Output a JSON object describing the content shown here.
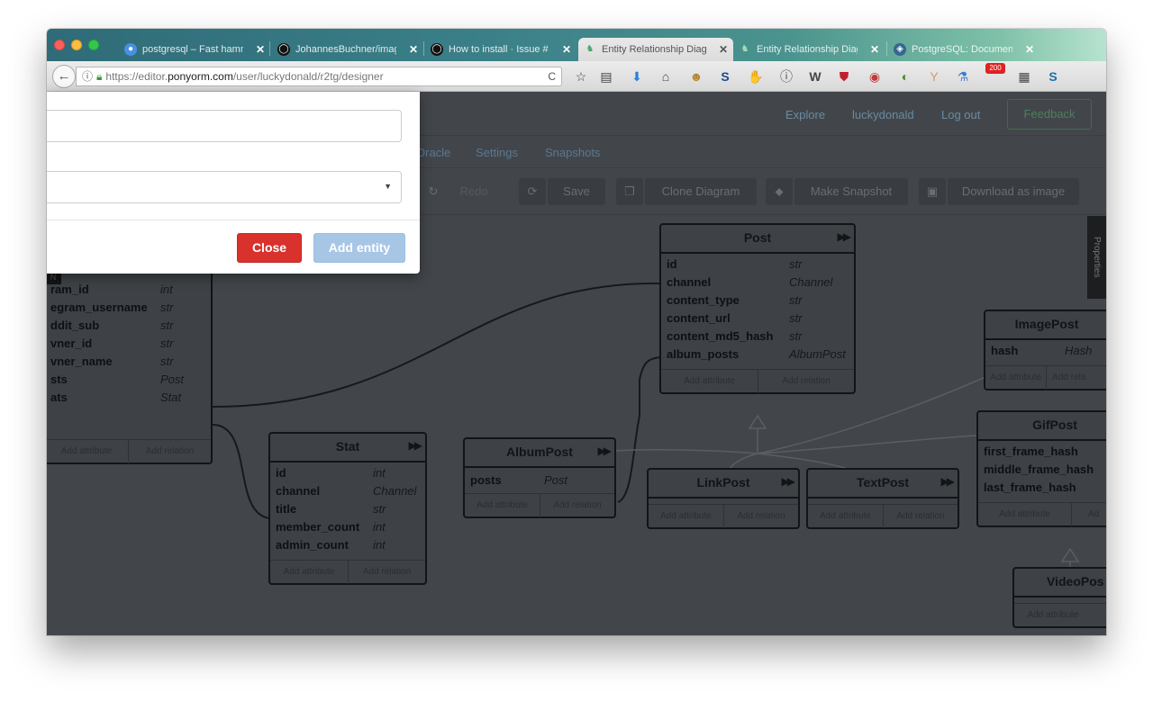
{
  "browser": {
    "tabs": [
      {
        "title": "postgresql – Fast hamm",
        "icon": "globe-icon",
        "icon_color": "#4a90e2"
      },
      {
        "title": "JohannesBuchner/imag",
        "icon": "github-icon",
        "icon_color": "#222222"
      },
      {
        "title": "How to install · Issue #",
        "icon": "github-icon",
        "icon_color": "#222222"
      },
      {
        "title": "Entity Relationship Diag",
        "icon": "ponyorm-icon",
        "icon_color": "#4ca36b"
      },
      {
        "title": "Entity Relationship Diag",
        "icon": "ponyorm-icon",
        "icon_color": "#4ca36b"
      },
      {
        "title": "PostgreSQL: Documen",
        "icon": "postgresql-icon",
        "icon_color": "#336791"
      }
    ],
    "url": {
      "prefix": "https://editor.",
      "domain": "ponyorm.com",
      "path": "/user/luckydonald/r2tg/designer"
    },
    "reload_glyph": "C",
    "toolbar_icons": [
      "☆",
      "▤",
      "⬇",
      "⌂",
      "☻",
      "S",
      "✋",
      "ⓘ",
      "W",
      "⛊",
      "◉",
      "◐",
      "Y",
      "⚗",
      "200",
      "▦",
      "S"
    ],
    "badge_200": "200"
  },
  "site_nav": {
    "explore": "Explore",
    "user": "luckydonald",
    "logout": "Log out",
    "feedback": "Feedback"
  },
  "sub_nav": {
    "oracle": "Oracle",
    "settings": "Settings",
    "snapshots": "Snapshots"
  },
  "toolbar": {
    "redo": "Redo",
    "save": "Save",
    "clone": "Clone Diagram",
    "snapshot": "Make Snapshot",
    "download": "Download as image"
  },
  "properties_tab": "Properties",
  "entities": {
    "left": {
      "attrs": [
        {
          "name": "ram_id",
          "type": "int"
        },
        {
          "name": "egram_username",
          "type": "str"
        },
        {
          "name": "ddit_sub",
          "type": "str"
        },
        {
          "name": "vner_id",
          "type": "str"
        },
        {
          "name": "vner_name",
          "type": "str"
        },
        {
          "name": "sts",
          "type": "Post"
        },
        {
          "name": "ats",
          "type": "Stat"
        }
      ],
      "marker": "N"
    },
    "post": {
      "title": "Post",
      "attrs": [
        {
          "name": "id",
          "type": "str"
        },
        {
          "name": "channel",
          "type": "Channel"
        },
        {
          "name": "content_type",
          "type": "str"
        },
        {
          "name": "content_url",
          "type": "str"
        },
        {
          "name": "content_md5_hash",
          "type": "str"
        },
        {
          "name": "album_posts",
          "type": "AlbumPost"
        }
      ]
    },
    "stat": {
      "title": "Stat",
      "attrs": [
        {
          "name": "id",
          "type": "int"
        },
        {
          "name": "channel",
          "type": "Channel"
        },
        {
          "name": "title",
          "type": "str"
        },
        {
          "name": "member_count",
          "type": "int"
        },
        {
          "name": "admin_count",
          "type": "int"
        }
      ]
    },
    "albumpost": {
      "title": "AlbumPost",
      "attrs": [
        {
          "name": "posts",
          "type": "Post"
        }
      ]
    },
    "linkpost": {
      "title": "LinkPost"
    },
    "textpost": {
      "title": "TextPost"
    },
    "imagepost": {
      "title": "ImagePost",
      "attrs": [
        {
          "name": "hash",
          "type": "Hash"
        }
      ]
    },
    "gifpost": {
      "title": "GifPost",
      "attrs": [
        {
          "name": "first_frame_hash",
          "type": ""
        },
        {
          "name": "middle_frame_hash",
          "type": ""
        },
        {
          "name": "last_frame_hash",
          "type": ""
        }
      ]
    },
    "videopost": {
      "title": "VideoPos"
    }
  },
  "entity_footer": {
    "add_attribute": "Add attribute",
    "add_relation": "Add relation"
  },
  "entity_footer_clipped": {
    "add_relation_short": "Add rela",
    "add_short": "Ad"
  },
  "modal": {
    "close_label": "Close",
    "add_label": "Add entity",
    "close_color": "#d9312b",
    "add_color": "#a7c6e6"
  }
}
